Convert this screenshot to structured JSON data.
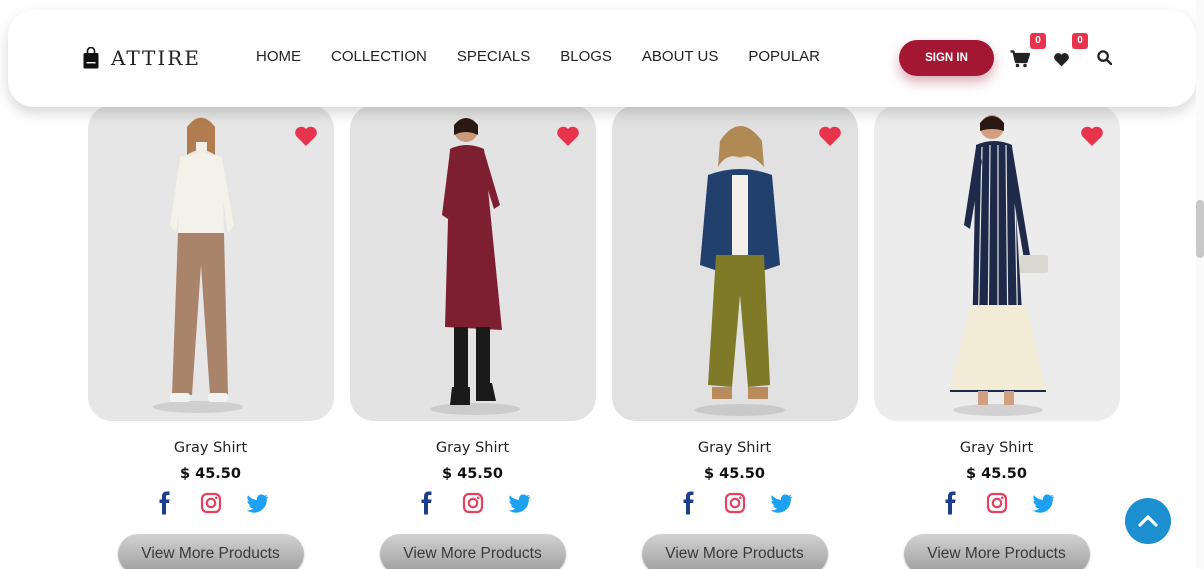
{
  "brand": {
    "name": "ATTIRE",
    "icon": "shopping-bag-icon"
  },
  "nav": [
    {
      "label": "HOME"
    },
    {
      "label": "COLLECTION"
    },
    {
      "label": "SPECIALS"
    },
    {
      "label": "BLOGS"
    },
    {
      "label": "ABOUT US"
    },
    {
      "label": "POPULAR"
    }
  ],
  "header_actions": {
    "signin_label": "SIGN IN",
    "cart_count": "0",
    "wishlist_count": "0",
    "cart_icon": "cart-icon",
    "wishlist_icon": "heart-icon",
    "search_icon": "search-icon"
  },
  "products": [
    {
      "name": "Gray Shirt",
      "price": "$ 45.50",
      "button": "View More Products"
    },
    {
      "name": "Gray Shirt",
      "price": "$ 45.50",
      "button": "View More Products"
    },
    {
      "name": "Gray Shirt",
      "price": "$ 45.50",
      "button": "View More Products"
    },
    {
      "name": "Gray Shirt",
      "price": "$ 45.50",
      "button": "View More Products"
    }
  ],
  "social_icons": [
    "facebook-icon",
    "instagram-icon",
    "twitter-icon"
  ],
  "colors": {
    "brand_accent": "#a31733",
    "badge": "#e8334d",
    "heart": "#e8334d",
    "facebook": "#1d3e8a",
    "instagram": "#e4405f",
    "twitter": "#1da1f2",
    "back_to_top": "#1b8fd0"
  }
}
